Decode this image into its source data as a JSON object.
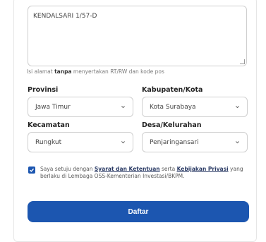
{
  "address": {
    "value": "KENDALSARI 1/57-D",
    "hint_prefix": "Isi alamat ",
    "hint_bold": "tanpa",
    "hint_suffix": " menyertakan RT/RW dan kode pos"
  },
  "fields": {
    "provinsi": {
      "label": "Provinsi",
      "value": "Jawa Timur"
    },
    "kabupaten": {
      "label": "Kabupaten/Kota",
      "value": "Kota Surabaya"
    },
    "kecamatan": {
      "label": "Kecamatan",
      "value": "Rungkut"
    },
    "desa": {
      "label": "Desa/Kelurahan",
      "value": "Penjaringansari"
    }
  },
  "agreement": {
    "checked": true,
    "text1": "Saya setuju dengan ",
    "link1": "Syarat dan Ketentuan",
    "text2": " serta ",
    "link2": "Kebijakan Privasi",
    "text3": " yang berlaku di Lembaga OSS-Kementerian Investasi/BKPM."
  },
  "submit_label": "Daftar",
  "colors": {
    "primary": "#1c56b0",
    "link": "#2c3c66",
    "border": "#cfcfcf"
  },
  "icons": {
    "select": "chevron-down-icon",
    "checkbox": "checkmark-icon",
    "resize": "resize-handle-icon"
  }
}
